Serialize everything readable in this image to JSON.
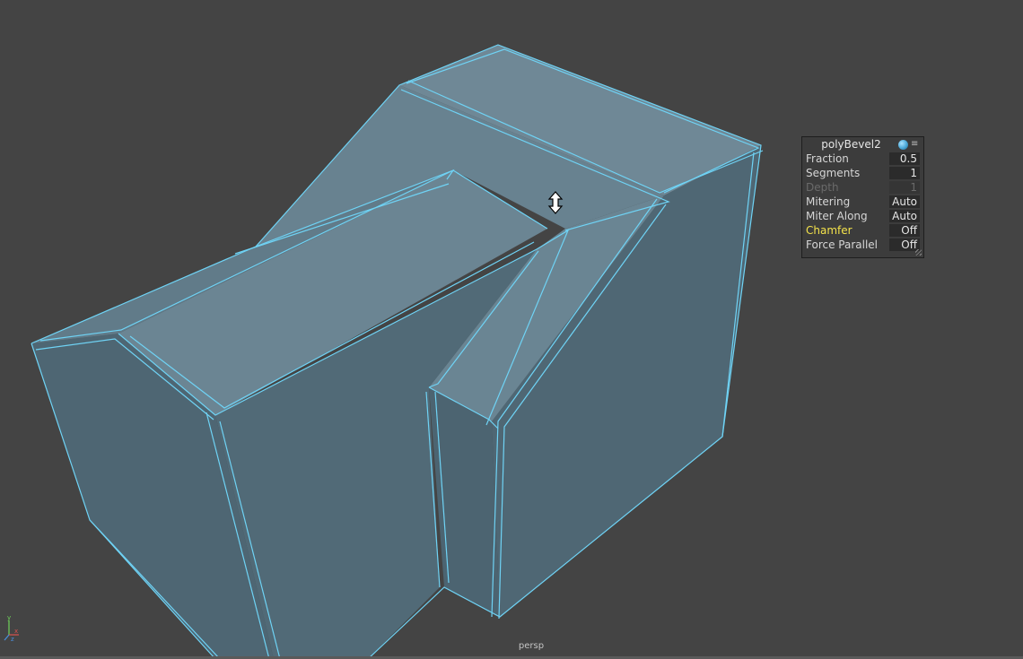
{
  "viewport": {
    "camera_label": "persp",
    "cursor": "vertical-move-cursor",
    "axis_gizmo": {
      "x_label": "x",
      "y_label": "y",
      "z_label": "z"
    }
  },
  "bevel_panel": {
    "title": "polyBevel2",
    "header_icons": [
      "globe-icon",
      "options-icon"
    ],
    "rows": [
      {
        "label": "Fraction",
        "value": "0.5"
      },
      {
        "label": "Segments",
        "value": "1"
      },
      {
        "label": "Depth",
        "value": "1",
        "disabled": true
      },
      {
        "label": "Mitering",
        "value": "Auto"
      },
      {
        "label": "Miter Along",
        "value": "Auto"
      },
      {
        "label": "Chamfer",
        "value": "Off",
        "highlighted": true
      },
      {
        "label": "Force Parallel",
        "value": "Off"
      }
    ]
  },
  "colors": {
    "background": "#444444",
    "wireframe": "#6fd3f5",
    "face_top": "#6c8694",
    "face_side": "#4f6775",
    "highlight_label": "#f3e24a"
  }
}
